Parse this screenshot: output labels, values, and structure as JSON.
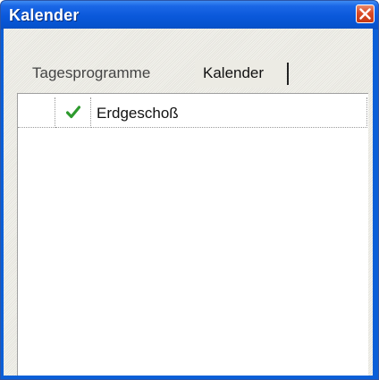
{
  "window": {
    "title": "Kalender",
    "close_icon": "close-icon",
    "accent_color": "#0a5fd8",
    "close_color": "#db4a25"
  },
  "tabs": [
    {
      "label": "Tagesprogramme",
      "active": false
    },
    {
      "label": "Kalender",
      "active": true
    }
  ],
  "grid": {
    "rows": [
      {
        "checked": true,
        "check_icon": "checkmark-icon",
        "check_color": "#2e9a2e",
        "label": "Erdgeschoß"
      }
    ]
  }
}
